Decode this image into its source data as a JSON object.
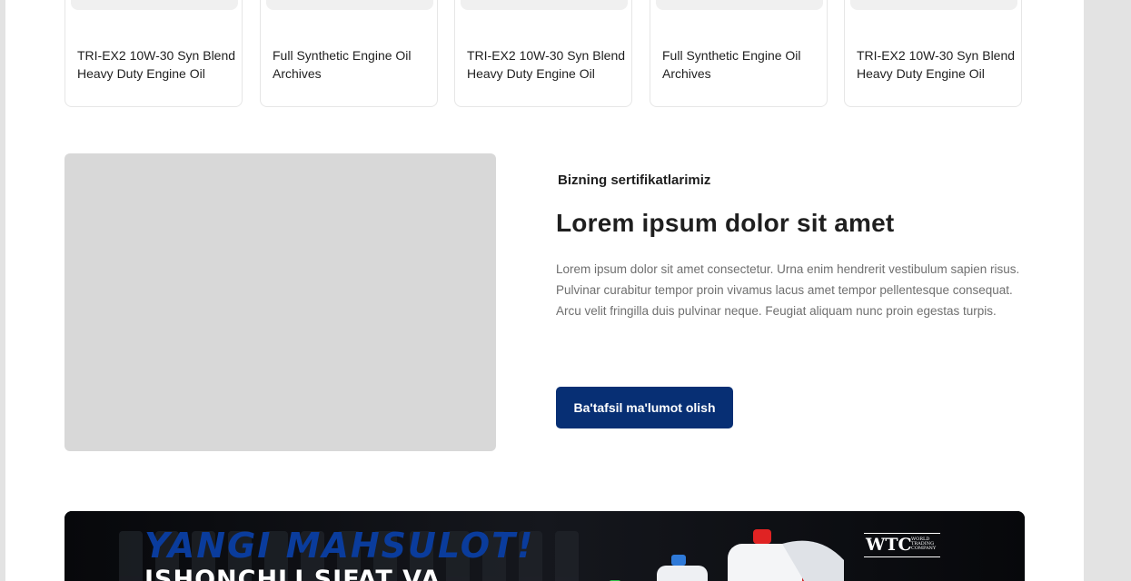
{
  "products": [
    {
      "title": "TRI-EX2 10W-30 Syn Blend Heavy Duty Engine Oil"
    },
    {
      "title": "Full Synthetic Engine Oil Archives"
    },
    {
      "title": "TRI-EX2 10W-30 Syn Blend Heavy Duty Engine Oil"
    },
    {
      "title": "Full Synthetic Engine Oil Archives"
    },
    {
      "title": "TRI-EX2 10W-30 Syn Blend Heavy Duty Engine Oil"
    }
  ],
  "certificates": {
    "kicker": "Bizning sertifikatlarimiz",
    "heading": "Lorem ipsum dolor sit amet",
    "body": "Lorem ipsum dolor sit amet consectetur. Urna enim hendrerit vestibulum sapien risus. Pulvinar curabitur tempor proin vivamus lacus amet tempor pellentesque consequat. Arcu velit fringilla duis pulvinar neque. Feugiat aliquam nunc proin egestas turpis.",
    "button_label": "Ba'tafsil ma'lumot olish"
  },
  "banner": {
    "headline": "YANGI MAHSULOT!",
    "subline": "ISHONCHLI SIFAT VA",
    "logo": {
      "mark": "WTC",
      "sub": "WORLD TRADING COMPANY"
    },
    "colors": {
      "headline": "#0a3c9c",
      "background": "#0b0d12"
    }
  },
  "colors": {
    "button": "#072f74",
    "image_placeholder": "#d8d8d8"
  }
}
